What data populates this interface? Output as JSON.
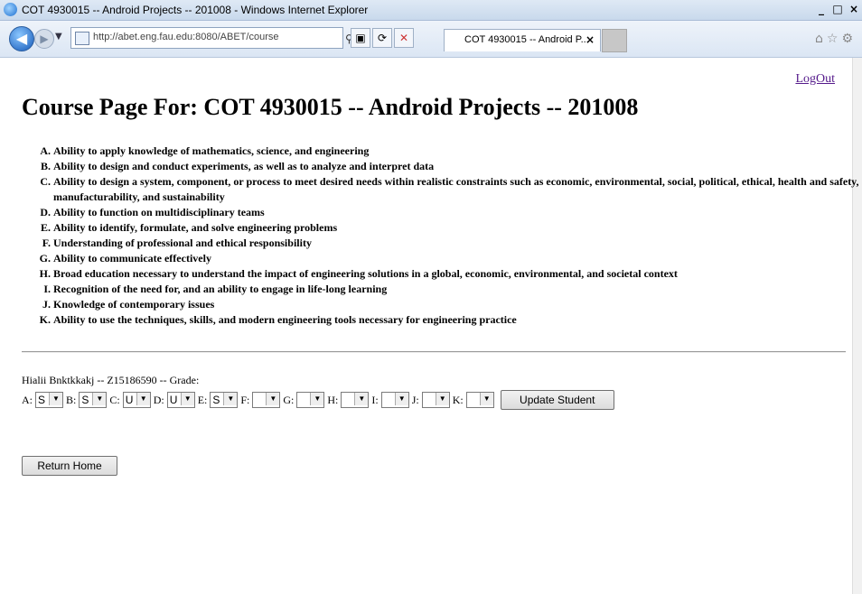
{
  "window": {
    "title": "COT 4930015 -- Android Projects -- 201008 - Windows Internet Explorer"
  },
  "browser": {
    "address": "http://abet.eng.fau.edu:8080/ABET/course",
    "tab_title": "COT 4930015 -- Android P..."
  },
  "page": {
    "logout_label": "LogOut",
    "heading": "Course Page For: COT 4930015 -- Android Projects -- 201008",
    "outcomes": [
      "Ability to apply knowledge of mathematics, science, and engineering",
      "Ability to design and conduct experiments, as well as to analyze and interpret data",
      "Ability to design a system, component, or process to meet desired needs within realistic constraints such as economic, environmental, social, political, ethical, health and safety, manufacturability, and sustainability",
      "Ability to function on multidisciplinary teams",
      "Ability to identify, formulate, and solve engineering problems",
      "Understanding of professional and ethical responsibility",
      "Ability to communicate effectively",
      "Broad education necessary to understand the impact of engineering solutions in a global, economic, environmental, and societal context",
      "Recognition of the need for, and an ability to engage in life-long learning",
      "Knowledge of contemporary issues",
      "Ability to use the techniques, skills, and modern engineering tools necessary for engineering practice"
    ],
    "student_line": "Hialii Bnktkkakj -- Z15186590 -- Grade:",
    "grades": [
      {
        "label": "A:",
        "value": "S"
      },
      {
        "label": "B:",
        "value": "S"
      },
      {
        "label": "C:",
        "value": "U"
      },
      {
        "label": "D:",
        "value": "U"
      },
      {
        "label": "E:",
        "value": "S"
      },
      {
        "label": "F:",
        "value": ""
      },
      {
        "label": "G:",
        "value": ""
      },
      {
        "label": "H:",
        "value": ""
      },
      {
        "label": "I:",
        "value": ""
      },
      {
        "label": "J:",
        "value": ""
      },
      {
        "label": "K:",
        "value": ""
      }
    ],
    "update_button": "Update Student",
    "return_button": "Return Home"
  }
}
